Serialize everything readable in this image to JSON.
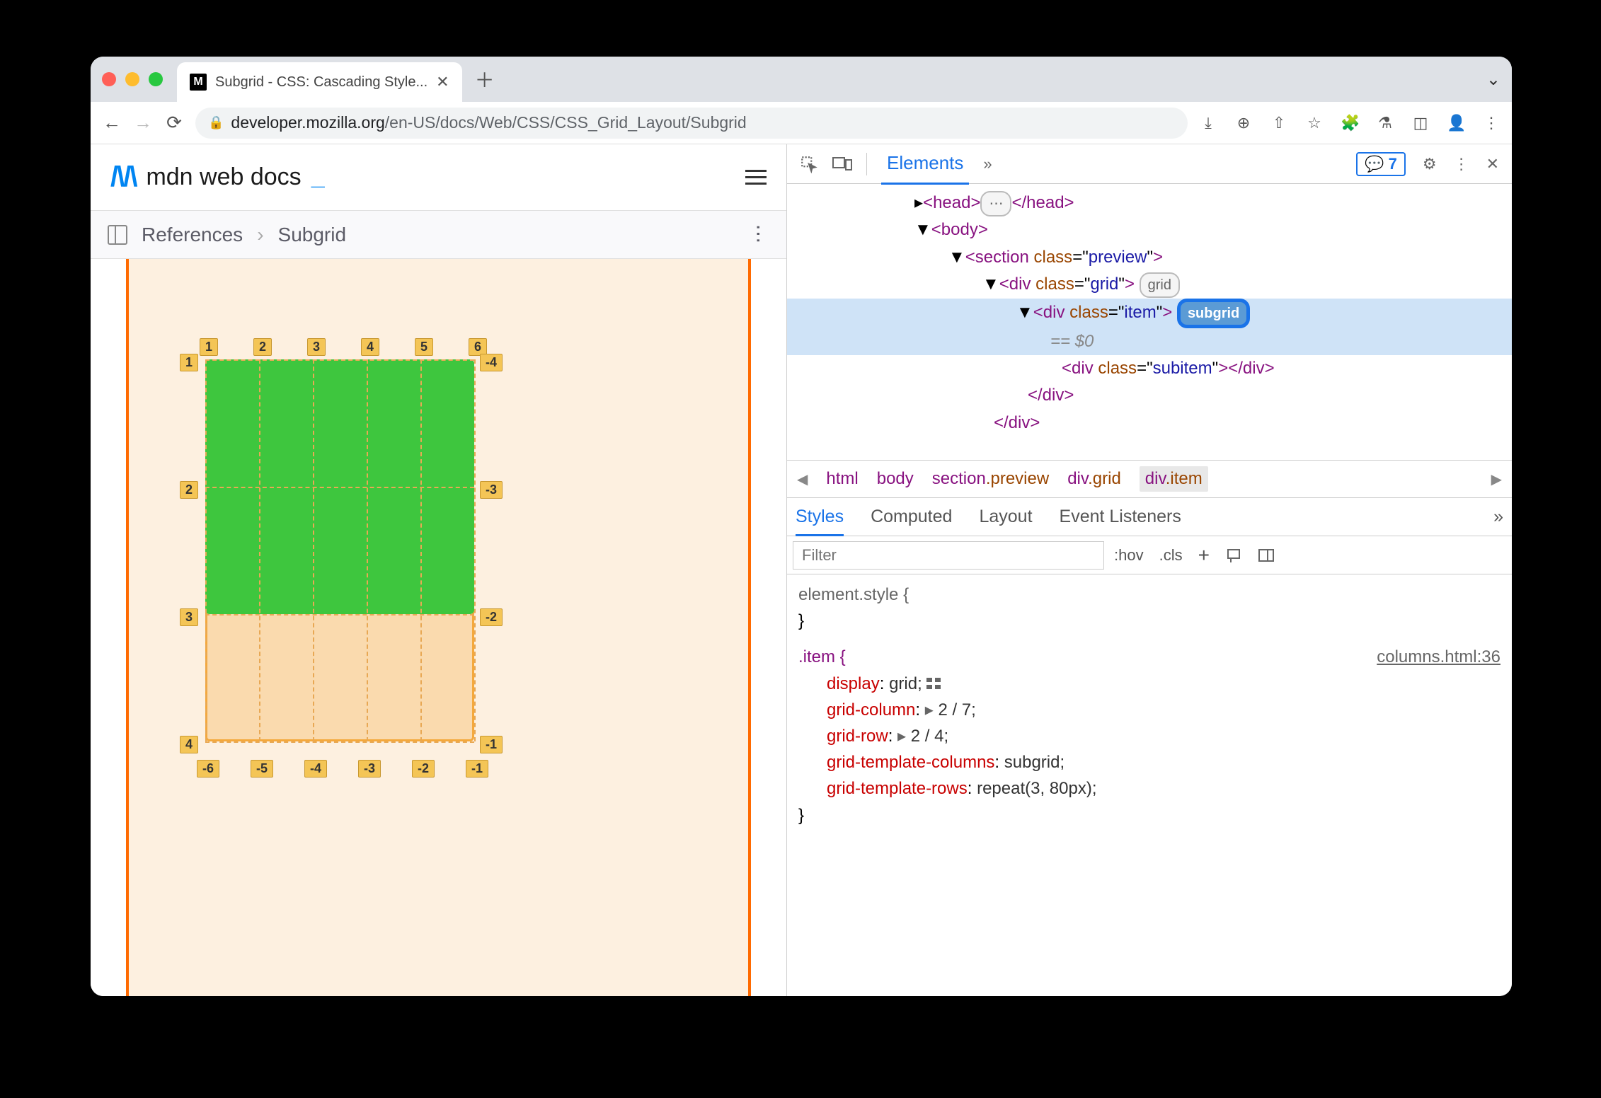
{
  "tab": {
    "title": "Subgrid - CSS: Cascading Style...",
    "favicon_letter": "M"
  },
  "url": {
    "host": "developer.mozilla.org",
    "path": "/en-US/docs/Web/CSS/CSS_Grid_Layout/Subgrid"
  },
  "mdn": {
    "logo_text": "mdn web docs",
    "caret": "_"
  },
  "breadcrumb": {
    "a": "References",
    "b": "Subgrid"
  },
  "grid_labels": {
    "top": [
      "1",
      "2",
      "3",
      "4",
      "5",
      "6"
    ],
    "left": [
      "1",
      "2",
      "3",
      "4"
    ],
    "right": [
      "-4",
      "-3",
      "-2",
      "-1"
    ],
    "bottom": [
      "-6",
      "-5",
      "-4",
      "-3",
      "-2",
      "-1"
    ]
  },
  "devtools": {
    "tab_active": "Elements",
    "msg_count": "7",
    "dom": {
      "head_open": "<head>",
      "head_ell": "⋯",
      "head_close": "</head>",
      "body_open": "<body>",
      "section_tag": "section",
      "section_class": "preview",
      "grid_tag": "div",
      "grid_class": "grid",
      "grid_pill": "grid",
      "item_tag": "div",
      "item_class": "item",
      "item_pill": "subgrid",
      "eq": "== $0",
      "subitem": "<div class=\"subitem\"></div>",
      "div_close": "</div>"
    },
    "crumbs": [
      "html",
      "body",
      "section.preview",
      "div.grid",
      "div.item"
    ],
    "style_tabs": [
      "Styles",
      "Computed",
      "Layout",
      "Event Listeners"
    ],
    "filter_placeholder": "Filter",
    "hov": ":hov",
    "cls": ".cls",
    "styles": {
      "element_style": "element.style {",
      "close": "}",
      "item_sel": ".item {",
      "item_link": "columns.html:36",
      "rules": [
        {
          "name": "display",
          "value": "grid;",
          "icon": true
        },
        {
          "name": "grid-column",
          "value": "2 / 7;",
          "tri": true
        },
        {
          "name": "grid-row",
          "value": "2 / 4;",
          "tri": true
        },
        {
          "name": "grid-template-columns",
          "value": "subgrid;"
        },
        {
          "name": "grid-template-rows",
          "value": "repeat(3, 80px);"
        }
      ]
    }
  }
}
